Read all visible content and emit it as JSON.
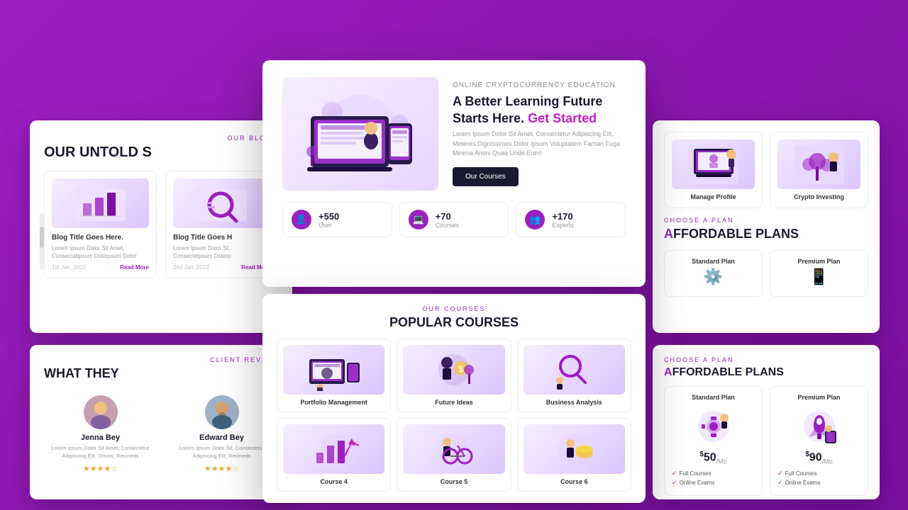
{
  "background": {
    "color": "#9b1fc1"
  },
  "main_card": {
    "hero": {
      "subtitle": "Online Cryptocurrency Education",
      "title_part1": "A Better Learning Future",
      "title_part2": "Starts Here.",
      "title_highlight": "Get Started",
      "description": "Lorem Ipsum Dolor Sit Amet, Consectetur Adipiscing Elit, Meteres Dignissimos Dolor Ipsum Voluptatem Farhan Fuga Minima Animi Quae Unde Eum!",
      "button_label": "Our Courses"
    },
    "stats": [
      {
        "value": "+550",
        "label": "User",
        "icon": "👤"
      },
      {
        "value": "+70",
        "label": "Courses",
        "icon": "💻"
      },
      {
        "value": "+170",
        "label": "Experts",
        "icon": "👥"
      }
    ]
  },
  "courses_card": {
    "section_label": "OUR COURSES",
    "section_title": "POPULAR COURSES",
    "items": [
      {
        "name": "Portfolio Management",
        "emoji": "📊"
      },
      {
        "name": "Future Ideas",
        "emoji": "💡"
      },
      {
        "name": "Business Analysis",
        "emoji": "🔍"
      },
      {
        "name": "Course 4",
        "emoji": "📈"
      },
      {
        "name": "Course 5",
        "emoji": "🚀"
      },
      {
        "name": "Course 6",
        "emoji": "💰"
      }
    ]
  },
  "blog_card": {
    "section_label": "OUR BLOGS",
    "section_title": "OUR UNTOLD S",
    "items": [
      {
        "title": "Blog Title Goes Here.",
        "desc": "Lorem Ipsum Dolor Sit Amet, Consectatipsum Dolorpsum Dolor",
        "date": "1st Jan, 2022",
        "read": "Read More",
        "emoji": "📊"
      },
      {
        "title": "Blog Title Goes H",
        "desc": "Lorem Ipsum Dolor St, Consectetpsum Dolorp",
        "date": "2nd Jan, 2022",
        "read": "Read More",
        "emoji": "🔎"
      }
    ]
  },
  "testimonials_card": {
    "section_label": "CLIENT REVIEW",
    "section_title": "WHAT THEY",
    "items": [
      {
        "name": "Jenna Bey",
        "desc": "Lorem Ipsum Dolor Sit Amet, Consectetur Adipiscing Elit, Omnis, Recineds",
        "stars": 4,
        "emoji": "👩"
      },
      {
        "name": "Edward Bey",
        "desc": "Lorem Ipsum Dolor Sit, Consectetur Adipiscing Elit, Recineds",
        "stars": 4,
        "emoji": "👨"
      }
    ]
  },
  "right_top_card": {
    "features": [
      {
        "name": "Manage Profile",
        "emoji": "💻"
      },
      {
        "name": "Crypto Investing",
        "emoji": "🌱"
      }
    ],
    "plan_section_label": "CHOOSE A PLAN",
    "plan_section_title": "FFORDABLE PLANS",
    "plans": [
      {
        "name": "Standard Plan",
        "emoji": "⚙️"
      },
      {
        "name": "Premium Plan",
        "emoji": "📱"
      }
    ]
  },
  "right_bottom_card": {
    "section_label": "CHOOSE A PLAN",
    "section_title": "FFORDABLE PLANS",
    "plans": [
      {
        "name": "Standard Plan",
        "price": "50",
        "period": "Mo",
        "emoji": "⚙️",
        "features": [
          "Full Courses",
          "Online Exams"
        ]
      },
      {
        "name": "Premium Plan",
        "price": "90",
        "period": "Mo",
        "emoji": "🚀",
        "features": [
          "Full Courses",
          "Online Exams"
        ]
      }
    ]
  }
}
